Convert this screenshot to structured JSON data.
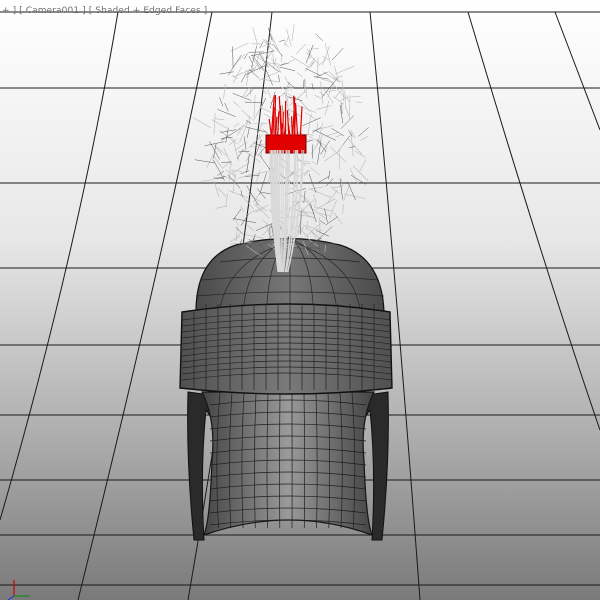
{
  "viewport": {
    "labels": [
      {
        "name": "viewport-menu",
        "text": "+ ]"
      },
      {
        "name": "viewport-camera",
        "text": " [ Camera001 ]"
      },
      {
        "name": "viewport-shading",
        "text": " [ Shaded + Edged Faces ]"
      }
    ]
  },
  "scene": {
    "object": "helmet",
    "crest_color": "#e00000",
    "mesh_color": "#5d5d5d",
    "wire_color": "#1a1a1a"
  },
  "axis_icon": {
    "name": "axis-tripod-icon",
    "colors": [
      "#d00000",
      "#1a8a1a",
      "#2040c0"
    ]
  }
}
